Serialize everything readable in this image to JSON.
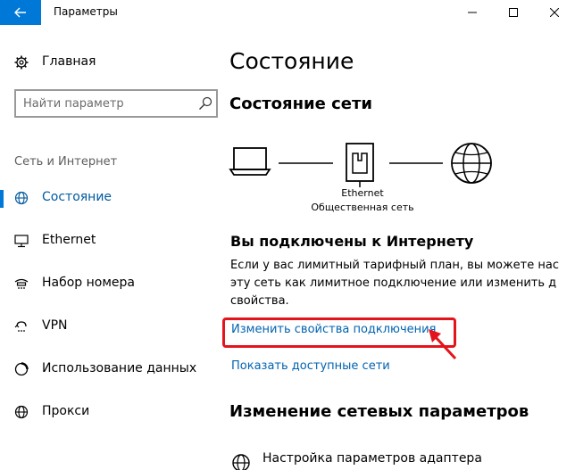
{
  "window": {
    "title": "Параметры",
    "accent_color": "#0078d7",
    "icons": {
      "back": "back-arrow-icon",
      "minimize": "minimize-icon",
      "maximize": "maximize-icon",
      "close": "close-icon"
    }
  },
  "sidebar": {
    "home_label": "Главная",
    "search_placeholder": "Найти параметр",
    "section_label": "Сеть и Интернет",
    "items": [
      {
        "label": "Состояние",
        "icon": "globe-network-icon",
        "active": true
      },
      {
        "label": "Ethernet",
        "icon": "ethernet-monitor-icon",
        "active": false
      },
      {
        "label": "Набор номера",
        "icon": "dialup-icon",
        "active": false
      },
      {
        "label": "VPN",
        "icon": "vpn-icon",
        "active": false
      },
      {
        "label": "Использование данных",
        "icon": "data-usage-icon",
        "active": false
      },
      {
        "label": "Прокси",
        "icon": "proxy-globe-icon",
        "active": false
      }
    ]
  },
  "main": {
    "page_title": "Состояние",
    "status_heading": "Состояние сети",
    "diagram": {
      "adapter_name": "Ethernet",
      "network_type": "Общественная сеть"
    },
    "connected_heading": "Вы подключены к Интернету",
    "connected_lines": [
      "Если у вас лимитный тарифный план, вы можете нас",
      "эту сеть как лимитное подключение или изменить д",
      "свойства."
    ],
    "link_change_properties": "Изменить свойства подключения",
    "link_show_networks": "Показать доступные сети",
    "change_heading": "Изменение сетевых параметров",
    "adapter_settings_label": "Настройка параметров адаптера",
    "annotation_color": "#e3141c",
    "link_color": "#0063b1"
  }
}
